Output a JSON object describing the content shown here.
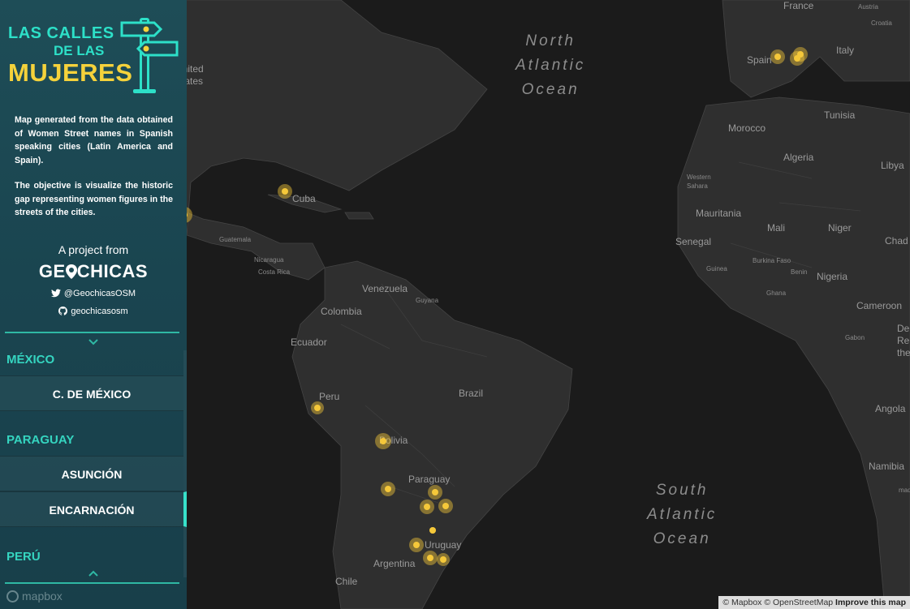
{
  "sidebar": {
    "logo": {
      "line1": "LAS CALLES",
      "line2": "DE LAS",
      "line3": "MUJERES"
    },
    "description": [
      "Map generated from the data obtained of Women Street names in Spanish speaking cities (Latin America and Spain).",
      "The objective is visualize the historic gap representing women figures in the streets of the cities."
    ],
    "project_from": "A project from",
    "brand_left": "GE",
    "brand_right": "CHICAS",
    "twitter": "@GeochicasOSM",
    "github": "geochicasosm",
    "sections": [
      {
        "country": "MÉXICO",
        "cities": [
          "C. DE MÉXICO"
        ]
      },
      {
        "country": "PARAGUAY",
        "cities": [
          "ASUNCIÓN",
          "ENCARNACIÓN"
        ]
      },
      {
        "country": "PERÚ",
        "cities": []
      }
    ],
    "active_city": "ENCARNACIÓN",
    "mapbox": "mapbox"
  },
  "map": {
    "labels": {
      "france": "France",
      "austria": "Austria",
      "croatia": "Croatia",
      "united_states": "United States",
      "spain": "Spain",
      "italy": "Italy",
      "tunisia": "Tunisia",
      "morocco": "Morocco",
      "algeria": "Algeria",
      "libya": "Libya",
      "western_sahara": "Western Sahara",
      "mauritania": "Mauritania",
      "mali": "Mali",
      "niger": "Niger",
      "chad": "Chad",
      "senegal": "Senegal",
      "guinea": "Guinea",
      "burkina_faso": "Burkina Faso",
      "benin": "Benin",
      "ghana": "Ghana",
      "nigeria": "Nigeria",
      "cameroon": "Cameroon",
      "gabon": "Gabon",
      "drc": "De\nRe\nthe",
      "angola": "Angola",
      "namibia": "Namibia",
      "mad": "mad",
      "cuba": "Cuba",
      "guatemala": "Guatemala",
      "nicaragua": "Nicaragua",
      "costa_rica": "Costa Rica",
      "venezuela": "Venezuela",
      "guyana": "Guyana",
      "colombia": "Colombia",
      "ecuador": "Ecuador",
      "peru": "Peru",
      "brazil": "Brazil",
      "bolivia": "Bolivia",
      "paraguay": "Paraguay",
      "uruguay": "Uruguay",
      "argentina": "Argentina",
      "chile": "Chile",
      "north_atlantic": "North\nAtlantic\nOcean",
      "south_atlantic": "South\nAtlantic\nOcean"
    },
    "marker_color": "#f5c83a",
    "attribution": {
      "mapbox": "© Mapbox",
      "osm": "© OpenStreetMap",
      "improve": "Improve this map"
    }
  }
}
